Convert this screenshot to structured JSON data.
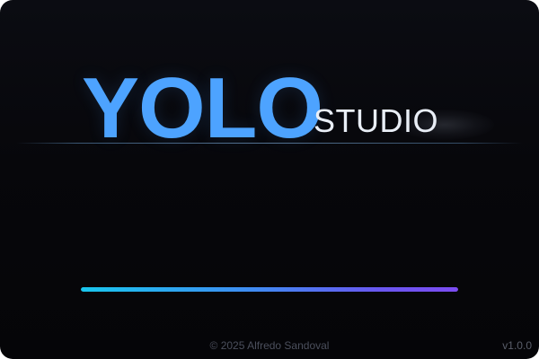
{
  "splash": {
    "logo_main": "YOLO",
    "logo_sub": "STUDIO",
    "progress": 1.0,
    "copyright": "© 2025 Alfredo Sandoval",
    "version": "v1.0.0"
  },
  "colors": {
    "background": "#07070b",
    "logo_main": "#4da3ff",
    "logo_sub": "#e9eef6",
    "progress_start": "#19c6ee",
    "progress_end": "#7c4cf2",
    "footer_text": "#4b4f5c"
  }
}
